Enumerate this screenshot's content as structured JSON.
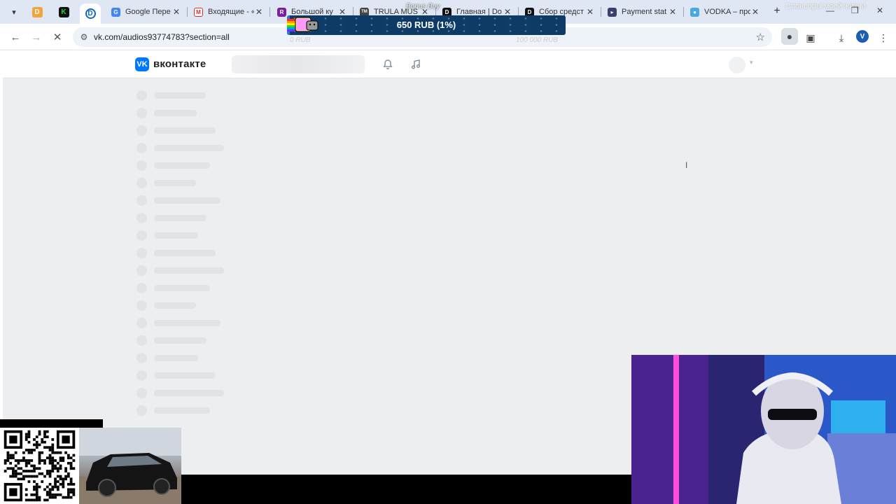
{
  "browser": {
    "pinned_tabs": [
      {
        "icon": "d-icon",
        "letter": "D",
        "color": "#f2a33a"
      },
      {
        "icon": "kick-icon",
        "letter": "K",
        "color": "#2fd22f"
      },
      {
        "icon": "donate-app-icon",
        "letter": "D",
        "color": "#1565c0"
      }
    ],
    "tabs": [
      {
        "title": "Google Пере",
        "favicon": "google-translate-icon",
        "favicon_color": "#4285f4",
        "favicon_letter": "G"
      },
      {
        "title": "Входящие - «",
        "favicon": "gmail-icon",
        "favicon_color": "#d93025",
        "favicon_letter": "M"
      },
      {
        "title": "Большой ку",
        "favicon": "r-icon",
        "favicon_color": "#7b1fa2",
        "favicon_letter": "R"
      },
      {
        "title": "TRULA MUS",
        "favicon": "tm-icon",
        "favicon_color": "#444444",
        "favicon_letter": "TM"
      },
      {
        "title": "Главная | Do",
        "favicon": "d-dark-icon",
        "favicon_color": "#111111",
        "favicon_letter": "D"
      },
      {
        "title": "Сбор средст",
        "favicon": "d-dark-icon",
        "favicon_color": "#111111",
        "favicon_letter": "D"
      },
      {
        "title": "Payment stat",
        "favicon": "payment-icon",
        "favicon_color": "#3b3f6b",
        "favicon_letter": "▸"
      },
      {
        "title": "VODKA – про",
        "favicon": "vodka-icon",
        "favicon_color": "#4aa8e0",
        "favicon_letter": "●"
      }
    ],
    "overlay_text": "Спонсоры моей жизни",
    "url": "vk.com/audios93774783?section=all",
    "profile_letter": "V"
  },
  "donation": {
    "label": "Bonus Buy",
    "amount_text": "650 RUB (1%)",
    "progress_fraction": 0.01,
    "min_label": "0 RUB",
    "max_label": "100 000 RUB",
    "bar_color": "#0e3a66"
  },
  "vk": {
    "brand_name": "вконтакте",
    "logo_letter": "VK",
    "accent": "#0077ff",
    "skeleton_rows": [
      74,
      61,
      88,
      100,
      80,
      60,
      95,
      75,
      63,
      88,
      100,
      80,
      60,
      95,
      75,
      63,
      88,
      100,
      80
    ]
  }
}
